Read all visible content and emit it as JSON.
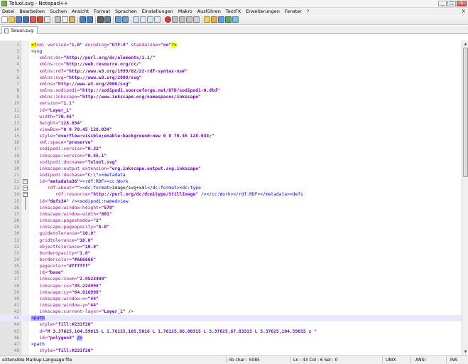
{
  "window": {
    "title": "Toluol.svg - Notepad++",
    "minimize": "_",
    "maximize": "□",
    "close": "X"
  },
  "menu": {
    "items": [
      "Datei",
      "Bearbeiten",
      "Suchen",
      "Ansicht",
      "Format",
      "Sprachen",
      "Einstellungen",
      "Makro",
      "Ausführen",
      "TextFX",
      "Erweiterungen",
      "Fenster",
      "?"
    ],
    "close_glyph": "X"
  },
  "tabs": [
    {
      "label": "Toluol.svg"
    }
  ],
  "editor": {
    "current_line": 43,
    "lines": [
      {
        "n": "1",
        "html": "<span class=\"pi-bg\">&lt;?</span><span class=\"pi\">xml version=</span><span class=\"val\">\"1.0\"</span><span class=\"pi\"> encoding=</span><span class=\"val\">\"UTF-8\"</span><span class=\"pi\"> standalone=</span><span class=\"val\">\"no\"</span><span class=\"pi-bg\">?&gt;</span>"
      },
      {
        "n": "2",
        "html": "<span class=\"tag\">&lt;svg</span>"
      },
      {
        "n": "3",
        "html": "   <span class=\"attr\">xmlns:dc=</span><span class=\"val\">\"http://purl.org/dc/elements/1.1/\"</span>"
      },
      {
        "n": "4",
        "html": "   <span class=\"attr\">xmlns:cc=</span><span class=\"val\">\"http://web.resource.org/cc/\"</span>"
      },
      {
        "n": "5",
        "html": "   <span class=\"attr\">xmlns:rdf=</span><span class=\"val\">\"http://www.w3.org/1999/02/22-rdf-syntax-ns#\"</span>"
      },
      {
        "n": "6",
        "html": "   <span class=\"attr\">xmlns:svg=</span><span class=\"val\">\"http://www.w3.org/2000/svg\"</span>"
      },
      {
        "n": "7",
        "html": "   <span class=\"attr\">xmlns=</span><span class=\"val\">\"http://www.w3.org/2000/svg\"</span>"
      },
      {
        "n": "8",
        "html": "   <span class=\"attr\">xmlns:sodipodi=</span><span class=\"val\">\"http://sodipodi.sourceforge.net/DTD/sodipodi-0.dtd\"</span>"
      },
      {
        "n": "9",
        "html": "   <span class=\"attr\">xmlns:inkscape=</span><span class=\"val\">\"http://www.inkscape.org/namespaces/inkscape\"</span>"
      },
      {
        "n": "10",
        "html": "   <span class=\"attr\">version=</span><span class=\"val\">\"1.1\"</span>"
      },
      {
        "n": "11",
        "html": "   <span class=\"attr\">id=</span><span class=\"val\">\"Layer_1\"</span>"
      },
      {
        "n": "12",
        "html": "   <span class=\"attr\">width=</span><span class=\"val\">\"70.45\"</span>"
      },
      {
        "n": "13",
        "html": "   <span class=\"attr\">height=</span><span class=\"val\">\"128.034\"</span>"
      },
      {
        "n": "14",
        "html": "   <span class=\"attr\">viewBox=</span><span class=\"val\">\"0 0 70.45 128.034\"</span>"
      },
      {
        "n": "15",
        "html": "   <span class=\"attr\">style=</span><span class=\"val\">\"overflow:visible;enable-background:new 0 0 70.45 128.034;\"</span>"
      },
      {
        "n": "16",
        "html": "   <span class=\"attr\">xml:space=</span><span class=\"val\">\"preserve\"</span>"
      },
      {
        "n": "17",
        "html": "   <span class=\"attr\">sodipodi:version=</span><span class=\"val\">\"0.32\"</span>"
      },
      {
        "n": "18",
        "html": "   <span class=\"attr\">inkscape:version=</span><span class=\"val\">\"0.45.1\"</span>"
      },
      {
        "n": "19",
        "html": "   <span class=\"attr\">sodipodi:docname=</span><span class=\"val\">\"Toluol.svg\"</span>"
      },
      {
        "n": "20",
        "html": "   <span class=\"attr\">inkscape:output_extension=</span><span class=\"val\">\"org.inkscape.output.svg.inkscape\"</span>"
      },
      {
        "n": "21",
        "html": "   <span class=\"attr\">sodipodi:docbase=</span><span class=\"val\">\"C:\\\"</span><span class=\"tag\">&gt;&lt;metadata</span>"
      },
      {
        "n": "22",
        "html": "   <span class=\"attr\">id=</span><span class=\"val\">\"metadata36\"</span><span class=\"tag\">&gt;&lt;rdf:RDF&gt;&lt;cc:Work</span>"
      },
      {
        "n": "23",
        "html": "      <span class=\"attr\">rdf:about=</span><span class=\"val\">\"\"</span><span class=\"tag\">&gt;&lt;dc:format&gt;</span><span class=\"txt\">image/svg+xml</span><span class=\"tag\">&lt;/dc:format&gt;&lt;dc:type</span>"
      },
      {
        "n": "24",
        "html": "         <span class=\"attr\">rdf:resource=</span><span class=\"val\">\"http://purl.org/dc/dcmitype/StillImage\"</span><span class=\"tag\"> /&gt;&lt;/cc:Work&gt;&lt;/rdf:RDF&gt;&lt;/metadata&gt;&lt;defs</span>"
      },
      {
        "n": "25",
        "html": "   <span class=\"attr\">id=</span><span class=\"val\">\"defs34\"</span><span class=\"tag\"> /&gt;&lt;sodipodi:namedview</span>"
      },
      {
        "n": "26",
        "html": "   <span class=\"attr\">inkscape:window-height=</span><span class=\"val\">\"579\"</span>"
      },
      {
        "n": "27",
        "html": "   <span class=\"attr\">inkscape:window-width=</span><span class=\"val\">\"801\"</span>"
      },
      {
        "n": "28",
        "html": "   <span class=\"attr\">inkscape:pageshadow=</span><span class=\"val\">\"2\"</span>"
      },
      {
        "n": "29",
        "html": "   <span class=\"attr\">inkscape:pageopacity=</span><span class=\"val\">\"0.0\"</span>"
      },
      {
        "n": "30",
        "html": "   <span class=\"attr\">guidetolerance=</span><span class=\"val\">\"10.0\"</span>"
      },
      {
        "n": "31",
        "html": "   <span class=\"attr\">gridtolerance=</span><span class=\"val\">\"10.0\"</span>"
      },
      {
        "n": "32",
        "html": "   <span class=\"attr\">objecttolerance=</span><span class=\"val\">\"10.0\"</span>"
      },
      {
        "n": "33",
        "html": "   <span class=\"attr\">borderopacity=</span><span class=\"val\">\"1.0\"</span>"
      },
      {
        "n": "34",
        "html": "   <span class=\"attr\">bordercolor=</span><span class=\"val\">\"#666666\"</span>"
      },
      {
        "n": "35",
        "html": "   <span class=\"attr\">pagecolor=</span><span class=\"val\">\"#ffffff\"</span>"
      },
      {
        "n": "36",
        "html": "   <span class=\"attr\">id=</span><span class=\"val\">\"base\"</span>"
      },
      {
        "n": "37",
        "html": "   <span class=\"attr\">inkscape:zoom=</span><span class=\"val\">\"2.9523409\"</span>"
      },
      {
        "n": "38",
        "html": "   <span class=\"attr\">inkscape:cx=</span><span class=\"val\">\"35.224998\"</span>"
      },
      {
        "n": "39",
        "html": "   <span class=\"attr\">inkscape:cy=</span><span class=\"val\">\"64.016998\"</span>"
      },
      {
        "n": "40",
        "html": "   <span class=\"attr\">inkscape:window-x=</span><span class=\"val\">\"44\"</span>"
      },
      {
        "n": "41",
        "html": "   <span class=\"attr\">inkscape:window-y=</span><span class=\"val\">\"44\"</span>"
      },
      {
        "n": "42",
        "html": "   <span class=\"attr\">inkscape:current-layer=</span><span class=\"val\">\"Layer_1\"</span><span class=\"tag\"> /&gt;</span>"
      },
      {
        "n": "43",
        "html": "<span class=\"tag hl-bg\">&lt;path</span>"
      },
      {
        "n": "44",
        "html": "   <span class=\"attr\">style=</span><span class=\"val\">\"fill:#231f20\"</span>"
      },
      {
        "n": "45",
        "html": "   <span class=\"attr\">d=</span><span class=\"val\">\"M 3.37625,104.59815 L 1.76125,105.5016 L 1.76125,66.80315 L 3.37625,67.83315 L 3.37625,104.59815 z \"</span>"
      },
      {
        "n": "46",
        "html": "   <span class=\"attr\">id=</span><span class=\"val\">\"polygon3\"</span> <span class=\"tag hl-bg\">/&gt;</span>"
      },
      {
        "n": "47",
        "html": "<span class=\"tag\">&lt;path</span>"
      },
      {
        "n": "48",
        "html": "   <span class=\"attr\">style=</span><span class=\"val\">\"fill:#231f20\"</span>"
      }
    ]
  },
  "status": {
    "file_type": "eXtensible Markup Language file",
    "nb_char": "nb char : 5085",
    "position": "Ln : 43   Col : 6   Sel : 0",
    "eol": "UNIX",
    "encoding": "ANSI",
    "mode": "INS"
  }
}
